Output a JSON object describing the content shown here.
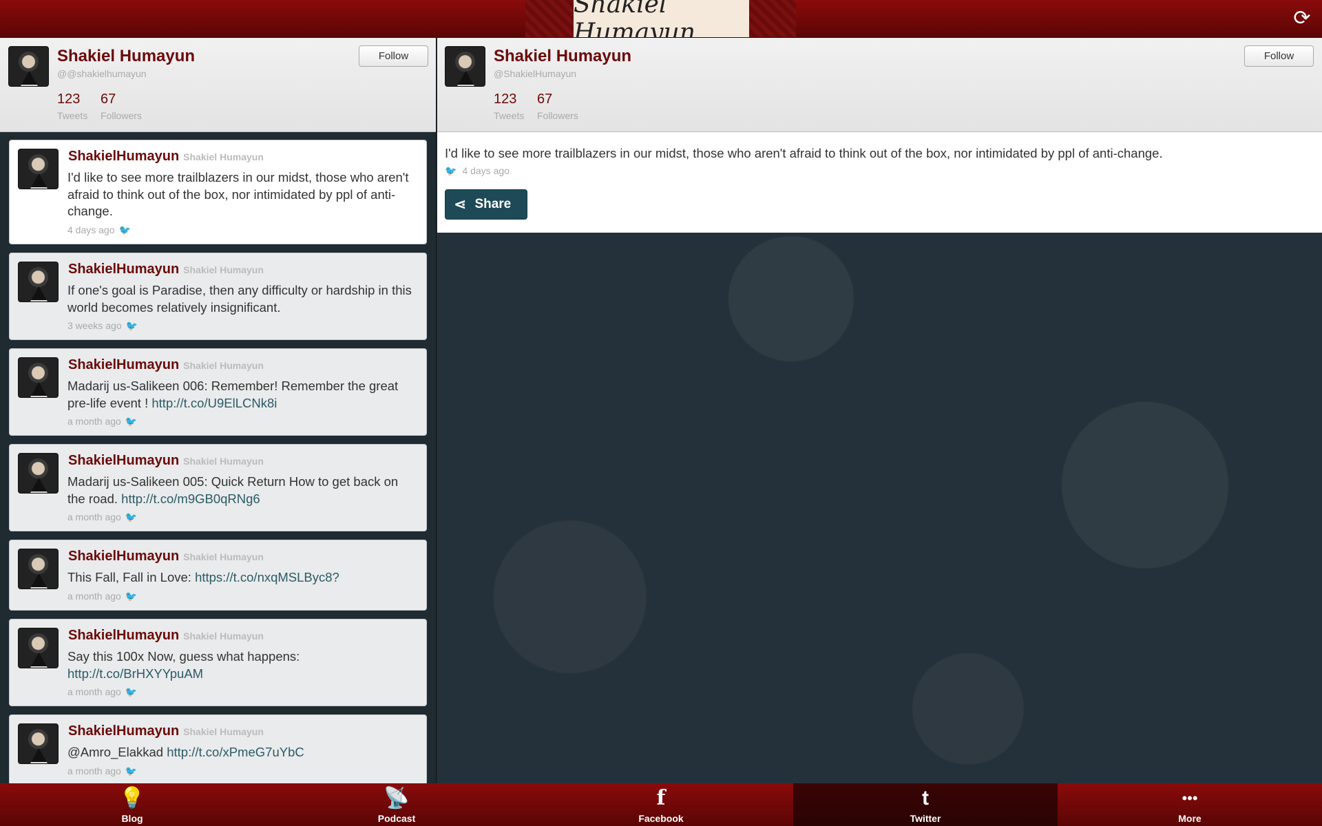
{
  "header": {
    "logo_text": "Shakiel Humayun",
    "refresh_icon": "refresh-icon"
  },
  "left_profile": {
    "name": "Shakiel Humayun",
    "handle": "@@shakielhumayun",
    "tweets_count": "123",
    "tweets_label": "Tweets",
    "followers_count": "67",
    "followers_label": "Followers",
    "follow_label": "Follow"
  },
  "tweets": [
    {
      "name": "ShakielHumayun",
      "sub": "Shakiel Humayun",
      "text": "I'd like to see more trailblazers in our midst, those who aren't afraid to think out of the box, nor intimidated by ppl of anti-change.",
      "link": "",
      "time": "4 days ago"
    },
    {
      "name": "ShakielHumayun",
      "sub": "Shakiel Humayun",
      "text": "If one's goal is Paradise, then any difficulty or hardship in this world becomes relatively insignificant.",
      "link": "",
      "time": "3 weeks ago"
    },
    {
      "name": "ShakielHumayun",
      "sub": "Shakiel Humayun",
      "text": "Madarij us-Salikeen 006: Remember! Remember the great pre-life event ! ",
      "link": "http://t.co/U9ElLCNk8i",
      "time": "a month ago"
    },
    {
      "name": "ShakielHumayun",
      "sub": "Shakiel Humayun",
      "text": "Madarij us-Salikeen 005: Quick Return How to get back on the road. ",
      "link": "http://t.co/m9GB0qRNg6",
      "time": "a month ago"
    },
    {
      "name": "ShakielHumayun",
      "sub": "Shakiel Humayun",
      "text": "This Fall, Fall in Love: ",
      "link": "https://t.co/nxqMSLByc8?",
      "time": "a month ago"
    },
    {
      "name": "ShakielHumayun",
      "sub": "Shakiel Humayun",
      "text": "Say this 100x Now, guess what happens: ",
      "link": "http://t.co/BrHXYYpuAM",
      "time": "a month ago"
    },
    {
      "name": "ShakielHumayun",
      "sub": "Shakiel Humayun",
      "text": "@Amro_Elakkad ",
      "link": "http://t.co/xPmeG7uYbC",
      "time": "a month ago"
    }
  ],
  "right_profile": {
    "name": "Shakiel Humayun",
    "handle": "@ShakielHumayun",
    "tweets_count": "123",
    "tweets_label": "Tweets",
    "followers_count": "67",
    "followers_label": "Followers",
    "follow_label": "Follow"
  },
  "detail": {
    "text": "I'd like to see more trailblazers in our midst, those who aren't afraid to think out of the box, nor intimidated by ppl of anti-change.",
    "time": "4 days ago",
    "share_label": "Share"
  },
  "footer": {
    "items": [
      {
        "label": "Blog",
        "icon": "lightbulb-icon",
        "glyph": "💡"
      },
      {
        "label": "Podcast",
        "icon": "satellite-dish-icon",
        "glyph": "📡"
      },
      {
        "label": "Facebook",
        "icon": "facebook-icon",
        "glyph": "f"
      },
      {
        "label": "Twitter",
        "icon": "twitter-icon",
        "glyph": "t"
      },
      {
        "label": "More",
        "icon": "more-icon",
        "glyph": "•••"
      }
    ]
  }
}
